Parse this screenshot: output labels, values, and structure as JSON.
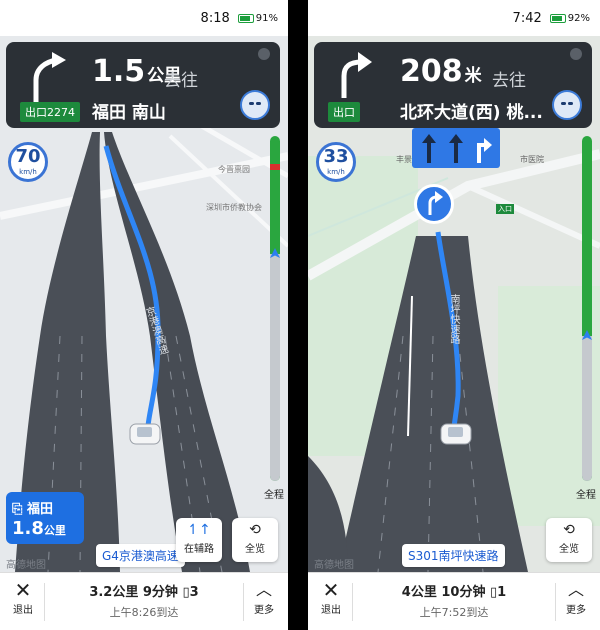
{
  "left": {
    "status": {
      "time": "8:18",
      "battery": "91"
    },
    "guide": {
      "distance": "1.5",
      "unit": "公里",
      "goto": "去往",
      "road": "福田 南山",
      "exit_badge": "出口2274",
      "turn": "slight-right"
    },
    "speed": {
      "value": "70",
      "unit": "km/h"
    },
    "map_labels": {
      "poi1": "今晋禀园",
      "poi2": "深圳市侨教协会",
      "road_on_map": "京港澳高速"
    },
    "fullroute": "全程",
    "destination": {
      "name": "福田",
      "distance": "1.8",
      "unit": "公里"
    },
    "current_road": "G4京港澳高速",
    "side_road_btn": "在辅路",
    "overview_btn": "全览",
    "logo": "高德地图",
    "bottom": {
      "exit": "退出",
      "summary": "3.2公里  9分钟",
      "lights": "3",
      "arrive": "上午8:26到达",
      "more": "更多"
    }
  },
  "right": {
    "status": {
      "time": "7:42",
      "battery": "92"
    },
    "guide": {
      "distance": "208",
      "unit": "米",
      "goto": "去往",
      "road": "北环大道(西) 桃...",
      "exit_badge": "出口",
      "turn": "right"
    },
    "speed": {
      "value": "33",
      "unit": "km/h"
    },
    "map_labels": {
      "poi1": "丰景台",
      "poi2": "市医院",
      "entry": "入口",
      "road_on_map": "南坪快速路"
    },
    "lanes": [
      "straight",
      "straight",
      "right"
    ],
    "fullroute": "全程",
    "current_road": "S301南坪快速路",
    "overview_btn": "全览",
    "logo": "高德地图",
    "bottom": {
      "exit": "退出",
      "summary": "4公里  10分钟",
      "lights": "1",
      "arrive": "上午7:52到达",
      "more": "更多"
    }
  },
  "colors": {
    "route_blue": "#2f86f5",
    "panel_dark": "#2b3036",
    "badge_green": "#1d8a3c",
    "accent_blue": "#1e6fe1"
  }
}
